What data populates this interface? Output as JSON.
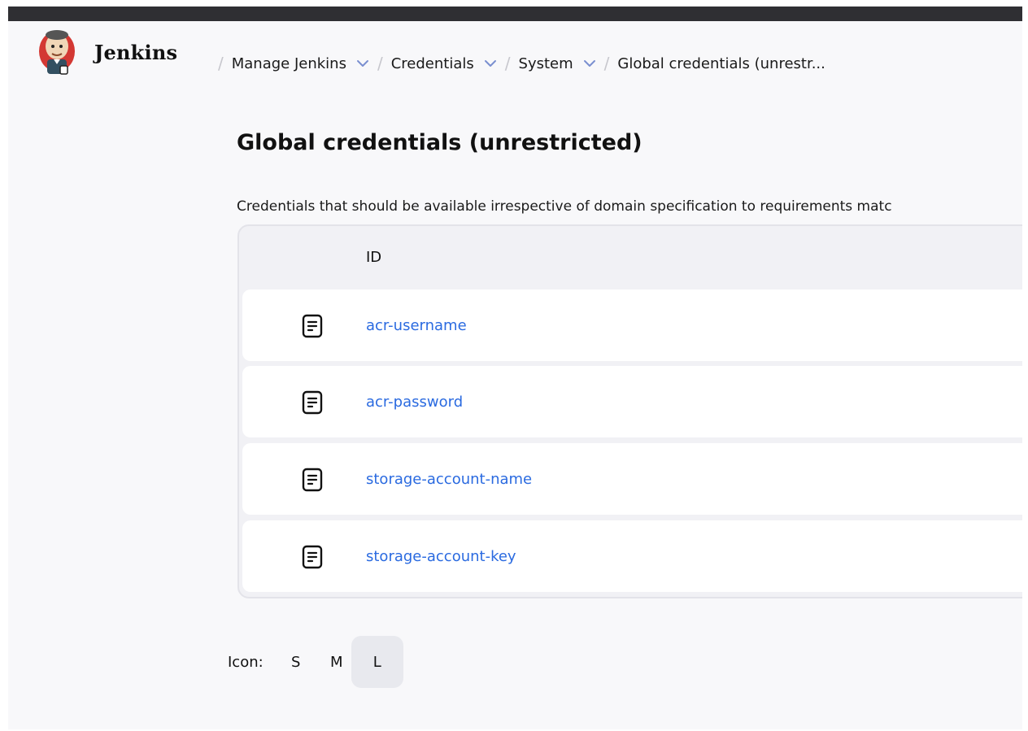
{
  "header": {
    "brand": "Jenkins",
    "breadcrumbs": [
      {
        "label": "Manage Jenkins",
        "has_dropdown": true
      },
      {
        "label": "Credentials",
        "has_dropdown": true
      },
      {
        "label": "System",
        "has_dropdown": true
      },
      {
        "label": "Global credentials (unrestr...",
        "has_dropdown": false
      }
    ],
    "separator": "/"
  },
  "main": {
    "title": "Global credentials (unrestricted)",
    "description": "Credentials that should be available irrespective of domain specification to requirements matc",
    "table": {
      "columns": [
        "ID"
      ],
      "rows": [
        {
          "id": "acr-username",
          "icon": "document-icon"
        },
        {
          "id": "acr-password",
          "icon": "document-icon"
        },
        {
          "id": "storage-account-name",
          "icon": "document-icon"
        },
        {
          "id": "storage-account-key",
          "icon": "document-icon"
        }
      ]
    },
    "icon_size": {
      "label": "Icon:",
      "options": [
        "S",
        "M",
        "L"
      ],
      "selected": "L"
    }
  },
  "colors": {
    "link": "#2a6ae0",
    "topbar": "#2f2f33",
    "background": "#f8f8fa",
    "active_size_bg": "#e8e9ee"
  }
}
